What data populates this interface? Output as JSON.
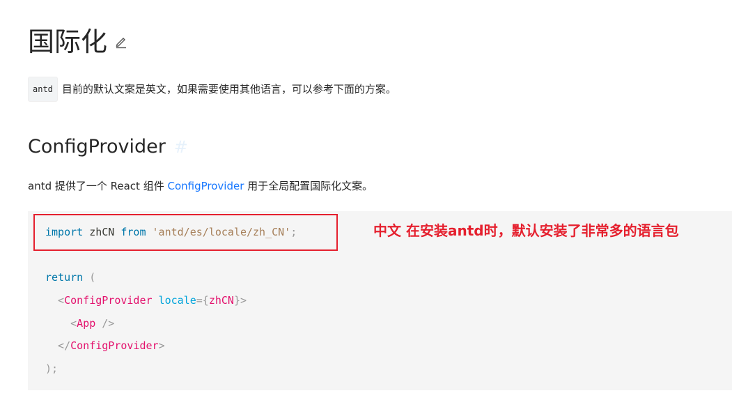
{
  "header": {
    "title": "国际化"
  },
  "intro": {
    "code": "antd",
    "text": "目前的默认文案是英文，如果需要使用其他语言，可以参考下面的方案。"
  },
  "section": {
    "title": "ConfigProvider",
    "anchor": "#",
    "desc_prefix": "antd 提供了一个 React 组件 ",
    "desc_link": "ConfigProvider",
    "desc_suffix": " 用于全局配置国际化文案。"
  },
  "code": {
    "import_kw": "import",
    "import_name": " zhCN ",
    "from_kw": "from",
    "import_path": " 'antd/es/locale/zh_CN'",
    "import_semicolon": ";",
    "return_kw": "return",
    "return_paren": " (",
    "open_tag_lt": "  <",
    "open_tag_name": "ConfigProvider",
    "attr_name": " locale",
    "attr_eq_open": "={",
    "attr_value": "zhCN",
    "attr_close": "}>",
    "app_lt": "    <",
    "app_name": "App",
    "app_close": " />",
    "close_tag_lt": "  </",
    "close_tag_name": "ConfigProvider",
    "close_tag_gt": ">",
    "end": ");"
  },
  "annotation": {
    "text": "中文    在安装antd时，默认安装了非常多的语言包"
  },
  "colors": {
    "link": "#1677ff",
    "annotation": "#e5202e",
    "code_bg": "#f5f5f5"
  }
}
